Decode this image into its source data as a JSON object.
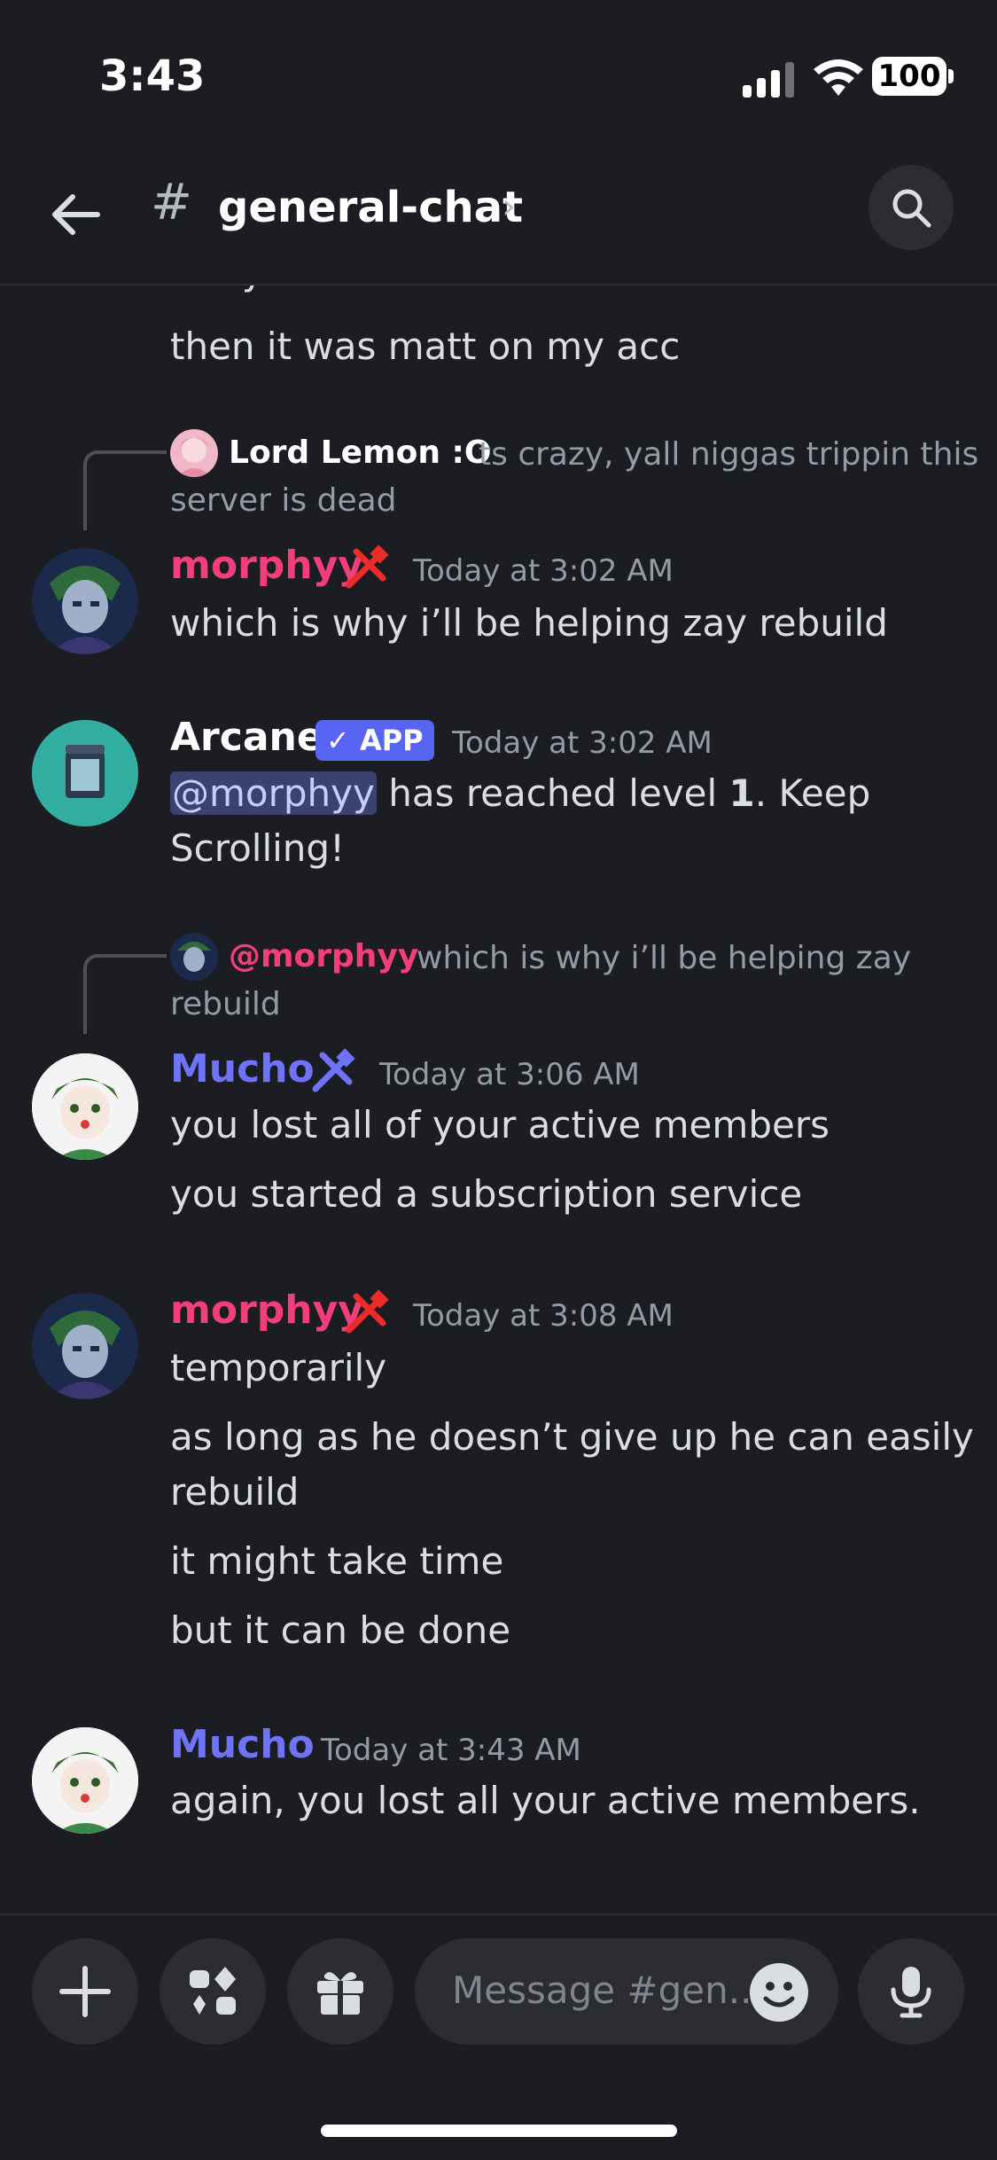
{
  "status_bar": {
    "time": "3:43",
    "battery": "100"
  },
  "header": {
    "hash": "#",
    "channel": "general-chat",
    "chevron": "›"
  },
  "colors": {
    "morphyy": "#f23f7a",
    "mucho": "#6f73f7",
    "lord_lemon": "#ffffff",
    "mention_bg": "#3c4270",
    "app_badge": "#5865f2"
  },
  "messages": {
    "partial_top": "if my account was involved",
    "m0_line": "then it was matt on my acc",
    "r1": {
      "reply_name": "Lord Lemon :O",
      "reply_text": "ts crazy, yall niggas trippin this",
      "reply_text2": "server is dead"
    },
    "m1": {
      "user": "morphyy",
      "time": "Today at 3:02 AM",
      "line1": "which is why i’ll be helping zay rebuild"
    },
    "m2": {
      "user": "Arcane",
      "badge": "APP",
      "time": "Today at 3:02 AM",
      "mention": "@morphyy",
      "text_a": " has reached level ",
      "level": "1",
      "text_b": ". Keep",
      "line2": "Scrolling!"
    },
    "r3": {
      "reply_name": "@morphyy",
      "reply_text": "which is why i’ll be helping zay",
      "reply_text2": "rebuild"
    },
    "m3": {
      "user": "Mucho",
      "time": "Today at 3:06 AM",
      "line1": "you lost all of your active members",
      "line2": "you started a subscription service"
    },
    "m4": {
      "user": "morphyy",
      "time": "Today at 3:08 AM",
      "line1": "temporarily",
      "line2": "as long as he doesn’t give up he can easily",
      "line3": "rebuild",
      "line4": "it might take time",
      "line5": "but it can be done"
    },
    "m5": {
      "user": "Mucho",
      "time": "Today at 3:43 AM",
      "line1": "again, you lost all your active members."
    }
  },
  "composer": {
    "placeholder": "Message #gen..."
  },
  "icons": [
    "back-arrow-icon",
    "search-icon",
    "hammer-icon",
    "check-icon",
    "plus-icon",
    "apps-icon",
    "gift-icon",
    "emoji-icon",
    "microphone-icon"
  ]
}
